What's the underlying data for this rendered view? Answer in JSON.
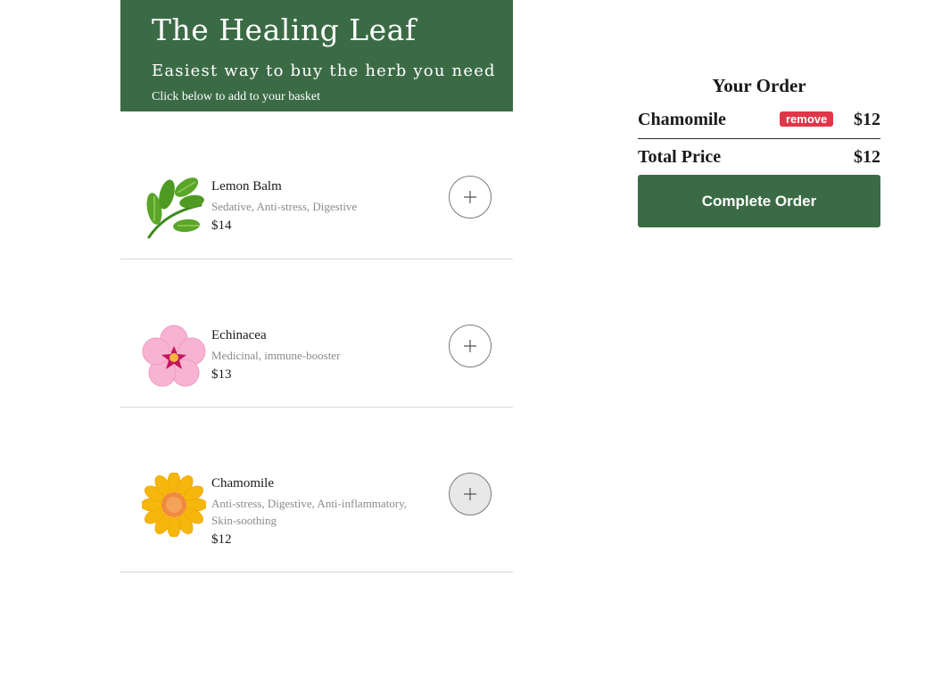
{
  "header": {
    "title": "The Healing Leaf",
    "subtitle": "Easiest way to buy the herb you need",
    "hint": "Click below to add to your basket"
  },
  "menu": {
    "items": [
      {
        "name": "Lemon Balm",
        "description": "Sedative, Anti-stress, Digestive",
        "price": "$14",
        "icon": "herb-leaves-icon",
        "add_label": "+"
      },
      {
        "name": "Echinacea",
        "description": "Medicinal, immune-booster",
        "price": "$13",
        "icon": "pink-blossom-icon",
        "add_label": "+"
      },
      {
        "name": "Chamomile",
        "description": "Anti-stress, Digestive, Anti-inflammatory, Skin-soothing",
        "price": "$12",
        "icon": "yellow-flower-icon",
        "add_label": "+"
      }
    ]
  },
  "order": {
    "heading": "Your Order",
    "lines": [
      {
        "name": "Chamomile",
        "remove_label": "remove",
        "price": "$12"
      }
    ],
    "total_label": "Total Price",
    "total_price": "$12",
    "complete_label": "Complete Order"
  },
  "colors": {
    "brand_green": "#3b6b45",
    "remove_red": "#e0364a",
    "muted_text": "#8a8a8a"
  }
}
